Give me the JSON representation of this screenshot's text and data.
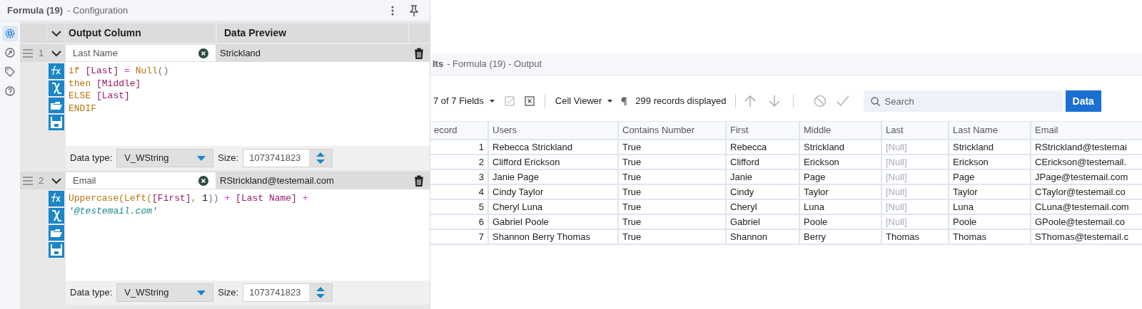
{
  "config_panel": {
    "title": "Formula (19)",
    "subtitle": "- Configuration",
    "sidebar": {
      "items": [
        {
          "selected": true
        },
        {
          "selected": false
        },
        {
          "selected": false
        },
        {
          "selected": false
        }
      ]
    },
    "columns": [
      "Output Column",
      "Data Preview"
    ],
    "expressions": [
      {
        "number": "1",
        "name": "Last Name",
        "preview": "Strickland",
        "data_type_label": "Data type:",
        "data_type": "V_WString",
        "size_label": "Size:",
        "size": "1073741823",
        "formula": [
          [
            {
              "text": "if ",
              "kind": "keyword"
            },
            {
              "text": "[Last]",
              "kind": "field"
            },
            {
              "text": " = ",
              "kind": "operator"
            },
            {
              "text": "Null",
              "kind": "function"
            },
            {
              "text": "()",
              "kind": "paren"
            }
          ],
          [
            {
              "text": "then ",
              "kind": "keyword"
            },
            {
              "text": "[Middle]",
              "kind": "field"
            }
          ],
          [
            {
              "text": "ELSE ",
              "kind": "keyword"
            },
            {
              "text": "[Last]",
              "kind": "field"
            }
          ],
          [
            {
              "text": "ENDIF",
              "kind": "keyword"
            }
          ]
        ]
      },
      {
        "number": "2",
        "name": "Email",
        "preview": "RStrickland@testemail.com",
        "data_type_label": "Data type:",
        "data_type": "V_WString",
        "size_label": "Size:",
        "size": "1073741823",
        "formula": [
          [
            {
              "text": "Uppercase(Left(",
              "kind": "function"
            },
            {
              "text": "[First]",
              "kind": "field"
            },
            {
              "text": ", ",
              "kind": "function"
            },
            {
              "text": "1",
              "kind": "number"
            },
            {
              "text": "))",
              "kind": "paren"
            },
            {
              "text": " + ",
              "kind": "operator"
            },
            {
              "text": "[Last Name]",
              "kind": "field"
            },
            {
              "text": " +",
              "kind": "operator"
            }
          ],
          [
            {
              "text": "'@testemail.com'",
              "kind": "string"
            }
          ]
        ]
      }
    ]
  },
  "results_panel": {
    "title": "lts",
    "subtitle": "- Formula (19) - Output",
    "toolbar": {
      "fields": "7 of 7 Fields",
      "viewer": "Cell Viewer",
      "records": "299 records displayed",
      "search_placeholder": "Search",
      "tabs": [
        {
          "label": "Data",
          "selected": true
        }
      ]
    },
    "table": {
      "columns": [
        "ecord",
        "Users",
        "Contains Number",
        "First",
        "Middle",
        "Last",
        "Last Name",
        "Email"
      ],
      "rows": [
        [
          {
            "text": "1"
          },
          {
            "text": "Rebecca Strickland"
          },
          {
            "text": "True"
          },
          {
            "text": "Rebecca"
          },
          {
            "text": "Strickland"
          },
          {
            "text": "[Null]",
            "null": true
          },
          {
            "text": "Strickland"
          },
          {
            "text": "RStrickland@testemai"
          }
        ],
        [
          {
            "text": "2"
          },
          {
            "text": "Clifford Erickson"
          },
          {
            "text": "True"
          },
          {
            "text": "Clifford"
          },
          {
            "text": "Erickson"
          },
          {
            "text": "[Null]",
            "null": true
          },
          {
            "text": "Erickson"
          },
          {
            "text": "CErickson@testemail."
          }
        ],
        [
          {
            "text": "3"
          },
          {
            "text": "Janie Page"
          },
          {
            "text": "True"
          },
          {
            "text": "Janie"
          },
          {
            "text": "Page"
          },
          {
            "text": "[Null]",
            "null": true
          },
          {
            "text": "Page"
          },
          {
            "text": "JPage@testemail.com"
          }
        ],
        [
          {
            "text": "4"
          },
          {
            "text": "Cindy Taylor"
          },
          {
            "text": "True"
          },
          {
            "text": "Cindy"
          },
          {
            "text": "Taylor"
          },
          {
            "text": "[Null]",
            "null": true
          },
          {
            "text": "Taylor"
          },
          {
            "text": "CTaylor@testemail.co"
          }
        ],
        [
          {
            "text": "5"
          },
          {
            "text": "Cheryl Luna"
          },
          {
            "text": "True"
          },
          {
            "text": "Cheryl"
          },
          {
            "text": "Luna"
          },
          {
            "text": "[Null]",
            "null": true
          },
          {
            "text": "Luna"
          },
          {
            "text": "CLuna@testemail.com"
          }
        ],
        [
          {
            "text": "6"
          },
          {
            "text": "Gabriel Poole"
          },
          {
            "text": "True"
          },
          {
            "text": "Gabriel"
          },
          {
            "text": "Poole"
          },
          {
            "text": "[Null]",
            "null": true
          },
          {
            "text": "Poole"
          },
          {
            "text": "GPoole@testemail.co"
          }
        ],
        [
          {
            "text": "7"
          },
          {
            "text": "Shannon Berry Thomas"
          },
          {
            "text": "True"
          },
          {
            "text": "Shannon"
          },
          {
            "text": "Berry"
          },
          {
            "text": "Thomas",
            "null": false
          },
          {
            "text": "Thomas"
          },
          {
            "text": "SThomas@testemail.c"
          }
        ]
      ]
    }
  }
}
